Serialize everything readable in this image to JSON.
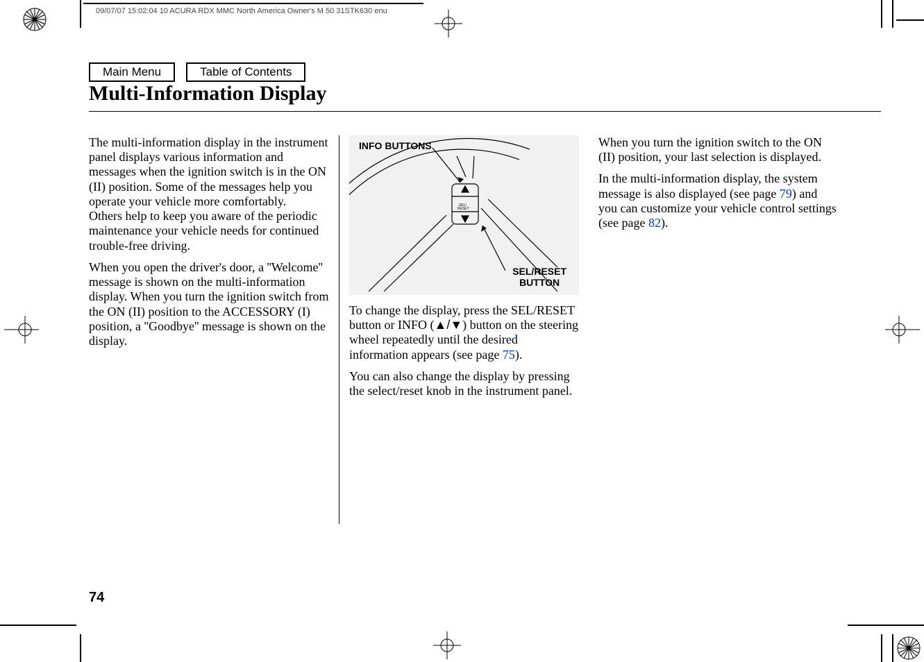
{
  "imprint": "09/07/07 15:02:04   10 ACURA RDX MMC North America Owner's M 50 31STK630 enu",
  "nav": {
    "main_menu": "Main Menu",
    "toc": "Table of Contents"
  },
  "title": "Multi-Information Display",
  "page_number": "74",
  "col1": {
    "p1": "The multi-information display in the instrument panel displays various information and messages when the ignition switch is in the ON (II) position. Some of the messages help you operate your vehicle more comfortably.",
    "p1b": "Others help to keep you aware of the periodic maintenance your vehicle needs for continued trouble-free driving.",
    "p2": "When you open the driver's door, a ''Welcome'' message is shown on the multi-information display. When you turn the ignition switch from the ON (II) position to the ACCESSORY (I) position, a ''Goodbye'' message is shown on the display."
  },
  "diagram": {
    "info_buttons_label": "INFO BUTTONS",
    "sel_reset_label_line1": "SEL/RESET",
    "sel_reset_label_line2": "BUTTON"
  },
  "col2": {
    "p1a": "To change the display, press the SEL/RESET button or INFO (",
    "p1b": ") button on the steering wheel repeatedly until the desired information appears (see page ",
    "p1_link": "75",
    "p1c": ").",
    "p2": "You can also change the display by pressing the select/reset knob in the instrument panel."
  },
  "col3": {
    "p1": "When you turn the ignition switch to the ON (II) position, your last selection is displayed.",
    "p2a": "In the multi-information display, the system message is also displayed (see page ",
    "p2_link1": "79",
    "p2b": ") and you can customize your vehicle control settings (see page ",
    "p2_link2": "82",
    "p2c": ")."
  }
}
